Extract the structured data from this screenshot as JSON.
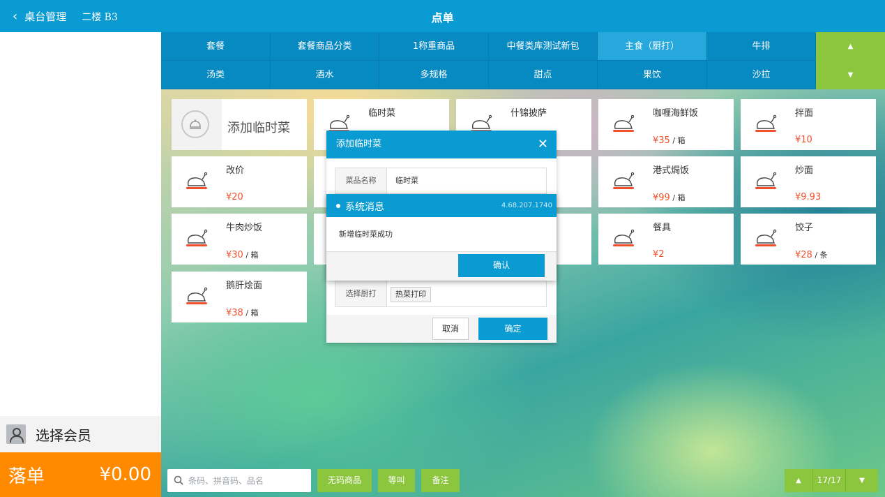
{
  "header": {
    "back_icon": "chevron-left-icon",
    "back_label": "桌台管理",
    "table": "二楼 B3",
    "title": "点单"
  },
  "left_panel": {
    "member_label": "选择会员",
    "member_icon": "user-icon",
    "order_label": "落单",
    "order_amount": "¥0.00"
  },
  "categories": {
    "row1": [
      "套餐",
      "套餐商品分类",
      "1称重商品",
      "中餐类库测试新包",
      "主食（厨打）",
      "牛排"
    ],
    "row2": [
      "汤类",
      "酒水",
      "多规格",
      "甜点",
      "果饮",
      "沙拉"
    ],
    "active": "主食（厨打）",
    "up_icon": "triangle-up-icon",
    "down_icon": "triangle-down-icon"
  },
  "products": {
    "add_temp_label": "添加临时菜",
    "add_temp_icon": "cloche-icon",
    "product_icon": "roast-chicken-icon",
    "items": [
      {
        "name": "临时菜",
        "price": "",
        "unit": ""
      },
      {
        "name": "什锦披萨",
        "price": "",
        "unit": ""
      },
      {
        "name": "咖喱海鲜饭",
        "price": "¥35",
        "unit": " / 箱"
      },
      {
        "name": "拌面",
        "price": "¥10",
        "unit": ""
      },
      {
        "name": "改价",
        "price": "¥20",
        "unit": ""
      },
      {
        "name": "港式焗饭",
        "price": "¥99",
        "unit": " / 箱"
      },
      {
        "name": "炒面",
        "price": "¥9.93",
        "unit": ""
      },
      {
        "name": "牛肉炒饭",
        "price": "¥30",
        "unit": " / 箱"
      },
      {
        "name": "餐具",
        "price": "¥2",
        "unit": ""
      },
      {
        "name": "饺子",
        "price": "¥28",
        "unit": " / 条"
      },
      {
        "name": "鹅肝烩面",
        "price": "¥38",
        "unit": " / 箱"
      }
    ]
  },
  "dialog_add_temp": {
    "title": "添加临时菜",
    "close_icon": "close-icon",
    "name_label": "菜品名称",
    "name_value": "临时菜",
    "printer_label": "选择厨打",
    "printer_value": "热菜打印",
    "cancel_label": "取消",
    "confirm_label": "确定"
  },
  "dialog_message": {
    "title": "系统消息",
    "version": "4.68.207.1740",
    "body": "新增临时菜成功",
    "ok_label": "确认"
  },
  "bottom": {
    "search_placeholder": "条码、拼音码、品名",
    "search_icon": "search-icon",
    "no_code_label": "无码商品",
    "wait_label": "等叫",
    "note_label": "备注",
    "page": "17/17"
  },
  "colors": {
    "primary": "#0b9bd3",
    "green": "#8cc63f",
    "orange": "#ff8a00",
    "price": "#f1502d"
  }
}
